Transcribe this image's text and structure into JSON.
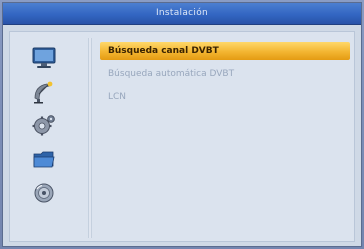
{
  "window": {
    "title": "Instalación"
  },
  "sidebar": {
    "icons": [
      {
        "name": "monitor-icon"
      },
      {
        "name": "satellite-dish-icon"
      },
      {
        "name": "settings-gear-icon"
      },
      {
        "name": "folder-icon"
      },
      {
        "name": "disc-icon"
      }
    ]
  },
  "menu": {
    "items": [
      {
        "label": "Búsqueda canal DVBT",
        "selected": true
      },
      {
        "label": "Búsqueda automática DVBT",
        "selected": false
      },
      {
        "label": "LCN",
        "selected": false
      }
    ]
  },
  "colors": {
    "titlebar": "#3366c2",
    "highlight": "#f3b531",
    "inactive_text": "#98a7bd"
  }
}
